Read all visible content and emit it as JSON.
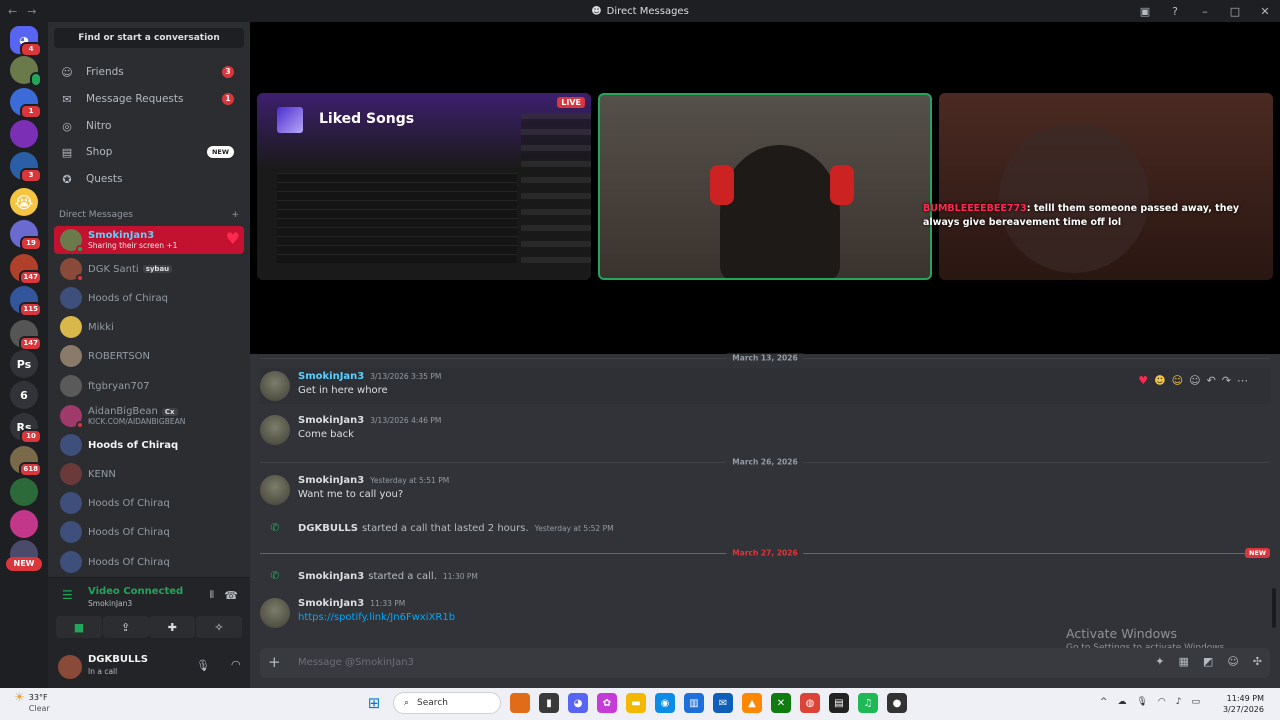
{
  "window": {
    "title": "Direct Messages"
  },
  "guilds": [
    {
      "label": "",
      "badge": "4"
    },
    {
      "label": "",
      "badge": ""
    },
    {
      "label": "",
      "badge": "1"
    },
    {
      "label": "",
      "badge": ""
    },
    {
      "label": "",
      "badge": "3"
    },
    {
      "label": "",
      "badge": ""
    },
    {
      "label": "",
      "badge": "19"
    },
    {
      "label": "",
      "badge": "147"
    },
    {
      "label": "",
      "badge": "115"
    },
    {
      "label": "",
      "badge": "147"
    },
    {
      "label": "Ps",
      "badge": ""
    },
    {
      "label": "6",
      "badge": ""
    },
    {
      "label": "Rs",
      "badge": "10"
    },
    {
      "label": "",
      "badge": "618"
    },
    {
      "label": "",
      "badge": ""
    },
    {
      "label": "",
      "badge": ""
    },
    {
      "label": "",
      "badge": ""
    }
  ],
  "guild_new": "NEW",
  "sidebar": {
    "find": "Find or start a conversation",
    "nav": [
      {
        "label": "Friends",
        "count": "3"
      },
      {
        "label": "Message Requests",
        "count": "1"
      },
      {
        "label": "Nitro",
        "count": ""
      },
      {
        "label": "Shop",
        "tag": "NEW"
      },
      {
        "label": "Quests",
        "count": ""
      }
    ],
    "dm_header": "Direct Messages",
    "dms": [
      {
        "name": "SmokinJan3",
        "sub": "Sharing their screen +1"
      },
      {
        "name": "DGK Santi",
        "tag": "sybau"
      },
      {
        "name": "Hoods of Chiraq"
      },
      {
        "name": "Mikki"
      },
      {
        "name": "ROBERTSON"
      },
      {
        "name": "ftgbryan707"
      },
      {
        "name": "AidanBigBean",
        "tag": "Cx",
        "sub": "KICK.COM/AIDANBIGBEAN"
      },
      {
        "name": "Hoods of Chiraq"
      },
      {
        "name": "KENN"
      },
      {
        "name": "Hoods Of Chiraq"
      },
      {
        "name": "Hoods Of Chiraq"
      },
      {
        "name": "Hoods Of Chiraq"
      }
    ]
  },
  "voice": {
    "title": "Video Connected",
    "channel": "SmokinJan3"
  },
  "user": {
    "name": "DGKBULLS",
    "status": "In a call"
  },
  "stage": {
    "screen_title": "Liked Songs",
    "live_label": "LIVE",
    "overlay_user": "BUMBLEEEEBEE773",
    "overlay_text": ": telll them someone passed away, they always give bereavement time off lol"
  },
  "messages": {
    "date1": "March 13, 2026",
    "m1": {
      "author": "SmokinJan3",
      "time": "3/13/2026 3:35 PM",
      "body": "Get in here whore"
    },
    "m2": {
      "author": "SmokinJan3",
      "time": "3/13/2026 4:46 PM",
      "body": "Come back"
    },
    "date2": "March 26, 2026",
    "m3": {
      "author": "SmokinJan3",
      "time": "Yesterday at 5:51 PM",
      "body": "Want me to call you?"
    },
    "call1": {
      "author": "DGKBULLS",
      "text": "started a call that lasted 2 hours.",
      "time": "Yesterday at 5:52 PM"
    },
    "date3": "March 27, 2026",
    "new_label": "NEW",
    "call2": {
      "author": "SmokinJan3",
      "text": "started a call.",
      "time": "11:30 PM"
    },
    "m4": {
      "author": "SmokinJan3",
      "time": "11:33 PM",
      "body": "https://spotify.link/Jn6FwxiXR1b"
    }
  },
  "composer": {
    "placeholder": "Message @SmokinJan3"
  },
  "activate": {
    "title": "Activate Windows",
    "sub": "Go to Settings to activate Windows."
  },
  "taskbar": {
    "temp": "33°F",
    "weather": "Clear",
    "search": "Search",
    "time": "11:49 PM",
    "date": "3/27/2026"
  },
  "colors": {
    "accent_red": "#c3122f",
    "online": "#23a55a",
    "link": "#00a8fc"
  }
}
